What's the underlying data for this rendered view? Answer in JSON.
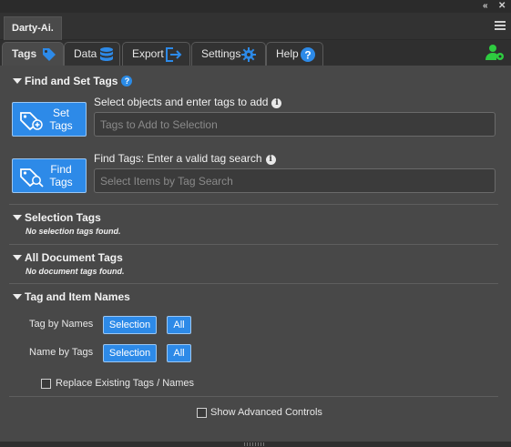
{
  "window": {
    "collapse_glyph": "«",
    "close_glyph": "✕"
  },
  "panel": {
    "title": "Darty-Ai."
  },
  "tabs": [
    {
      "label": "Tags",
      "icon": "tag-icon",
      "active": true
    },
    {
      "label": "Data",
      "icon": "database-icon",
      "active": false
    },
    {
      "label": "Export",
      "icon": "export-icon",
      "active": false
    },
    {
      "label": "Settings",
      "icon": "gear-icon",
      "active": false
    },
    {
      "label": "Help",
      "icon": "help-icon",
      "active": false
    }
  ],
  "find_set": {
    "title": "Find and Set Tags",
    "help_glyph": "?",
    "info_glyph": "i",
    "set_button": "Set\nTags",
    "set_label": "Select objects and enter tags to add",
    "set_placeholder": "Tags to Add to Selection",
    "find_button": "Find\nTags",
    "find_label": "Find Tags: Enter a valid tag search",
    "find_placeholder": "Select Items by Tag Search"
  },
  "selection_tags": {
    "title": "Selection Tags",
    "empty": "No selection tags found."
  },
  "all_document_tags": {
    "title": "All Document Tags",
    "empty": "No document tags found."
  },
  "tag_item_names": {
    "title": "Tag and Item Names",
    "tag_by_names": "Tag by Names",
    "name_by_tags": "Name by Tags",
    "selection_btn": "Selection",
    "all_btn": "All",
    "replace_label": "Replace Existing Tags / Names",
    "replace_checked": false
  },
  "advanced": {
    "label": "Show Advanced Controls",
    "checked": false
  },
  "colors": {
    "accent": "#2d8ae8",
    "user_icon": "#2ecc40",
    "panel_bg": "#484848"
  }
}
